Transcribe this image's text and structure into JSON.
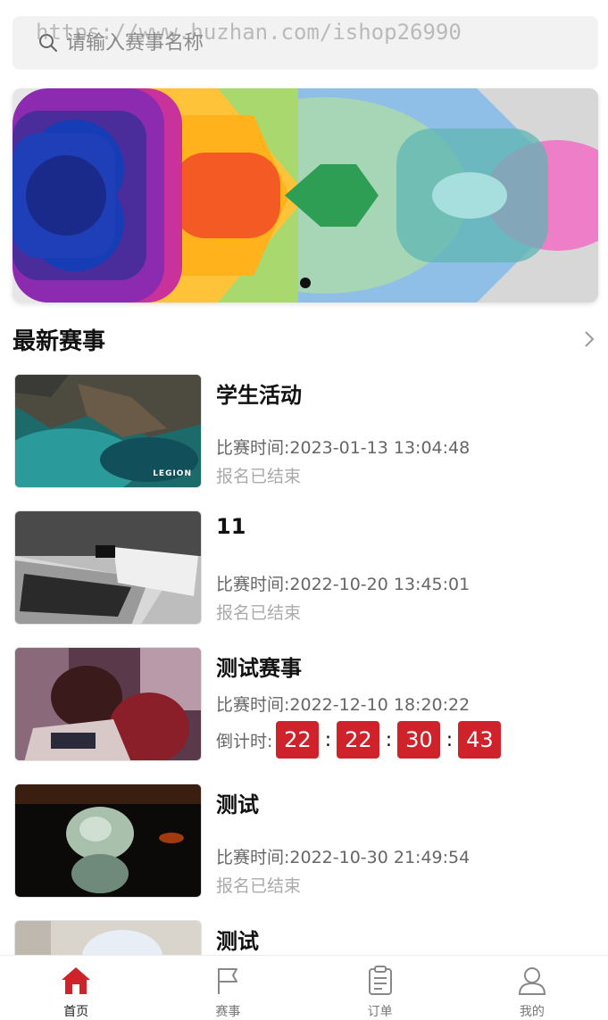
{
  "search": {
    "placeholder": "请输入赛事名称",
    "watermark": "https://www.huzhan.com/ishop26990"
  },
  "banner": {
    "slide_count": 1,
    "active_index": 0
  },
  "section": {
    "title": "最新赛事"
  },
  "events": [
    {
      "title": "学生活动",
      "time": "比赛时间:2023-01-13 13:04:48",
      "status": "报名已结束",
      "thumb_text": "LEGION"
    },
    {
      "title": "11",
      "time": "比赛时间:2022-10-20 13:45:01",
      "status": "报名已结束"
    },
    {
      "title": "测试赛事",
      "time": "比赛时间:2022-12-10 18:20:22",
      "countdown": {
        "label": "倒计时:",
        "days": "22",
        "hours": "22",
        "minutes": "30",
        "seconds": "43"
      }
    },
    {
      "title": "测试",
      "time": "比赛时间:2022-10-30 21:49:54",
      "status": "报名已结束"
    },
    {
      "title": "测试"
    }
  ],
  "tabbar": {
    "items": [
      {
        "label": "首页",
        "icon": "home-icon",
        "active": true
      },
      {
        "label": "赛事",
        "icon": "flag-icon",
        "active": false
      },
      {
        "label": "订单",
        "icon": "clipboard-icon",
        "active": false
      },
      {
        "label": "我的",
        "icon": "user-icon",
        "active": false
      }
    ]
  },
  "colors": {
    "accent": "#d0222b",
    "tab_active": "#d0222b"
  }
}
